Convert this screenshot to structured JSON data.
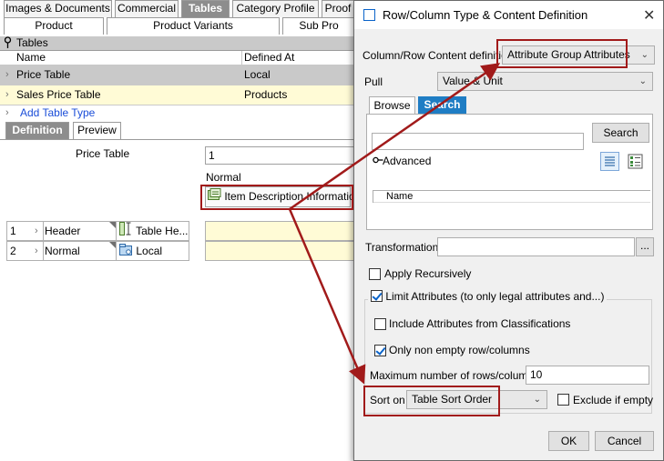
{
  "top_tabs": [
    "Images & Documents",
    "Commercial",
    "Tables",
    "Category Profile",
    "Proof"
  ],
  "sub_tabs": [
    "Product",
    "Product Variants",
    "Sub Pro"
  ],
  "tables": {
    "header": "Tables",
    "col_name": "Name",
    "col_defined": "Defined At",
    "rows": [
      {
        "name": "Price Table",
        "defined": "Local"
      },
      {
        "name": "Sales Price Table",
        "defined": "Products"
      }
    ],
    "add_label": "Add Table Type"
  },
  "def_tabs": [
    "Definition",
    "Preview"
  ],
  "definition": {
    "price_table_label": "Price Table",
    "price_table_value": "1",
    "normal_label": "Normal",
    "item_button": "Item Description Information",
    "grid": [
      {
        "num": "1",
        "type": "Header",
        "content": "Table He..."
      },
      {
        "num": "2",
        "type": "Normal",
        "content": "Local"
      }
    ]
  },
  "dialog": {
    "title": "Row/Column Type & Content Definition",
    "content_def_label": "Column/Row Content definition",
    "content_def_value": "Attribute Group Attributes",
    "pull_label": "Pull",
    "pull_value": "Value & Unit",
    "browse_tab": "Browse",
    "search_tab": "Search",
    "search_button": "Search",
    "advanced_label": "Advanced",
    "name_col": "Name",
    "transformation_label": "Transformation",
    "transformation_button": "...",
    "apply_recursively": "Apply Recursively",
    "limit_attributes": "Limit Attributes (to only legal attributes and...)",
    "include_classifications": "Include Attributes from Classifications",
    "only_non_empty": "Only non empty row/columns",
    "max_rows_label": "Maximum number of rows/columns",
    "max_rows_value": "10",
    "sort_on_label": "Sort on",
    "sort_on_value": "Table Sort Order",
    "exclude_if_empty": "Exclude if empty",
    "ok": "OK",
    "cancel": "Cancel"
  },
  "colors": {
    "highlight": "#a11a1a",
    "accent": "#0a63c9",
    "tab_active": "#8d8d8d",
    "row_selected": "#c9c9c9",
    "row_yellow": "#fffbd6"
  },
  "icons": [
    "pin-icon",
    "chevron-right-icon",
    "item-description-icon",
    "table-header-icon",
    "local-icon",
    "list-view-icon",
    "grid-view-icon",
    "close-icon",
    "key-icon",
    "window-icon"
  ]
}
